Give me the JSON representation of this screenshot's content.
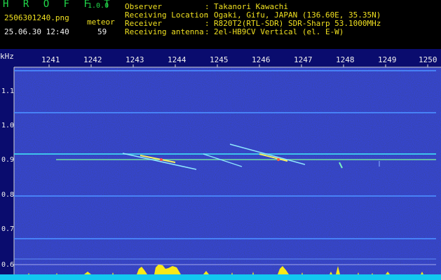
{
  "header": {
    "app_title": "H R O F F T",
    "app_version": "1.0.0",
    "file_name": "2506301240.png",
    "timestamp": "25.06.30 12:40",
    "meteor_label": "meteor",
    "meteor_count": "59"
  },
  "metadata": [
    {
      "key": "Observer",
      "value": "Takanori Kawachi"
    },
    {
      "key": "Receiving Location",
      "value": "Ogaki, Gifu, JAPAN (136.60E, 35.35N)"
    },
    {
      "key": "Receiver",
      "value": "R820T2(RTL-SDR) SDR-Sharp 53.1000MHz"
    },
    {
      "key": "Receiving antenna",
      "value": "2el-HB9CV Vertical (el. E-W)"
    }
  ],
  "separator": ":",
  "axes": {
    "y_unit": "kHz",
    "x_ticks": [
      "1241",
      "1242",
      "1243",
      "1244",
      "1245",
      "1246",
      "1247",
      "1248",
      "1249",
      "1250"
    ],
    "y_ticks": [
      "1.1",
      "1.0",
      "0.9",
      "0.8",
      "0.7",
      "0.6"
    ]
  },
  "colors": {
    "background": "#0a0c6e",
    "label_green": "#22d84a",
    "label_yellow": "#f0e020",
    "baseline_cyan": "#12c8f0",
    "signal_yellow": "#f8e818"
  }
}
